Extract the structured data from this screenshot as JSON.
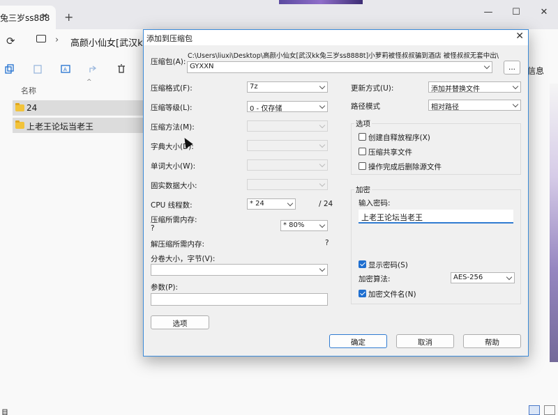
{
  "explorer": {
    "tab_title": "兔三岁ss888",
    "tab_close": "✕",
    "new_tab": "+",
    "window_controls": [
      "—",
      "☐",
      "✕"
    ],
    "path_text": "高颜小仙女[武汉kk兔",
    "info_label": "信息",
    "column_name": "名称",
    "sort_glyph": "^",
    "rows": [
      "24",
      "上老王论坛当老王"
    ],
    "status_left": "目"
  },
  "dialog": {
    "title": "添加到压缩包",
    "close": "✕",
    "archive_label": "压缩包(A):",
    "archive_path": "C:\\Users\\liuxi\\Desktop\\高颜小仙女[武汉kk兔三岁ss8888t]小萝莉被怪叔叔骗到酒店 被怪叔叔无套中出\\",
    "archive_name": "GYXXN",
    "browse": "...",
    "left": {
      "format_label": "压缩格式(F):",
      "format_value": "7z",
      "level_label": "压缩等级(L):",
      "level_value": "0 - 仅存储",
      "method_label": "压缩方法(M):",
      "dict_label": "字典大小(D):",
      "word_label": "单词大小(W):",
      "solid_label": "固实数据大小:",
      "cpu_label": "CPU 线程数:",
      "cpu_value": "* 24",
      "cpu_total": "/ 24",
      "mem_label": "压缩所需内存:",
      "mem_q": "?",
      "mem_value": "* 80%",
      "decomp_label": "解压缩所需内存:",
      "decomp_q": "?",
      "split_label": "分卷大小，字节(V):",
      "params_label": "参数(P):",
      "options_button": "选项"
    },
    "right": {
      "update_label": "更新方式(U):",
      "update_value": "添加并替换文件",
      "pathmode_label": "路径模式",
      "pathmode_value": "相对路径",
      "options_title": "选项",
      "opt_sfx": "创建自释放程序(X)",
      "opt_shared": "压缩共享文件",
      "opt_delete": "操作完成后删除源文件",
      "encrypt_title": "加密",
      "pwd_label": "输入密码:",
      "pwd_value": "上老王论坛当老王",
      "show_pwd": "显示密码(S)",
      "algo_label": "加密算法:",
      "algo_value": "AES-256",
      "enc_names": "加密文件名(N)"
    },
    "ok": "确定",
    "cancel": "取消",
    "help": "帮助"
  }
}
